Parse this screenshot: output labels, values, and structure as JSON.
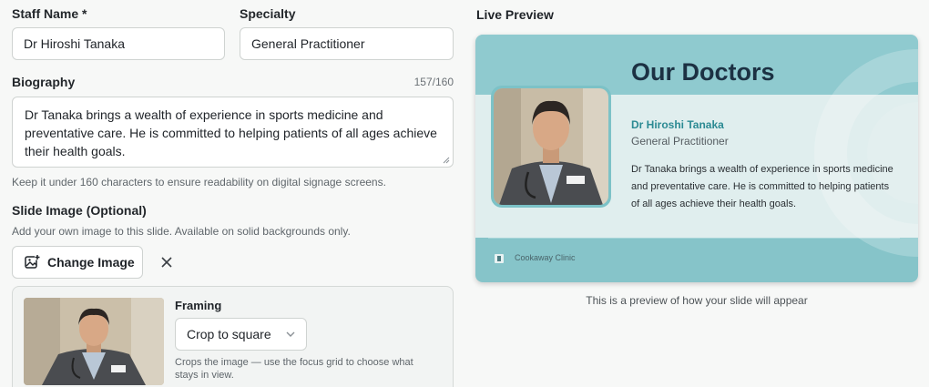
{
  "form": {
    "staff_name_label": "Staff Name *",
    "staff_name_value": "Dr Hiroshi Tanaka",
    "specialty_label": "Specialty",
    "specialty_value": "General Practitioner",
    "biography_label": "Biography",
    "biography_count": "157/160",
    "biography_value": "Dr Tanaka brings a wealth of experience in sports medicine and preventative care. He is committed to helping patients of all ages achieve their health goals.",
    "biography_hint": "Keep it under 160 characters to ensure readability on digital signage screens.",
    "slide_image_label": "Slide Image (Optional)",
    "slide_image_hint": "Add your own image to this slide. Available on solid backgrounds only.",
    "change_image_label": "Change Image",
    "remove_image_icon": "close-icon",
    "framing_label": "Framing",
    "framing_value": "Crop to square",
    "framing_hint": "Crops the image — use the focus grid to choose what stays in view."
  },
  "preview": {
    "label": "Live Preview",
    "card_title": "Our Doctors",
    "doctor_name": "Dr Hiroshi Tanaka",
    "doctor_specialty": "General Practitioner",
    "doctor_bio": "Dr Tanaka brings a wealth of experience in sports medicine and preventative care. He is committed to helping patients of all ages achieve their health goals.",
    "clinic_name": "Cookaway Clinic",
    "caption": "This is a preview of how your slide will appear"
  },
  "colors": {
    "accent_teal": "#2b8a93",
    "card_band": "#8fcacf",
    "card_body": "#e0eeee",
    "title_navy": "#1c3143"
  }
}
